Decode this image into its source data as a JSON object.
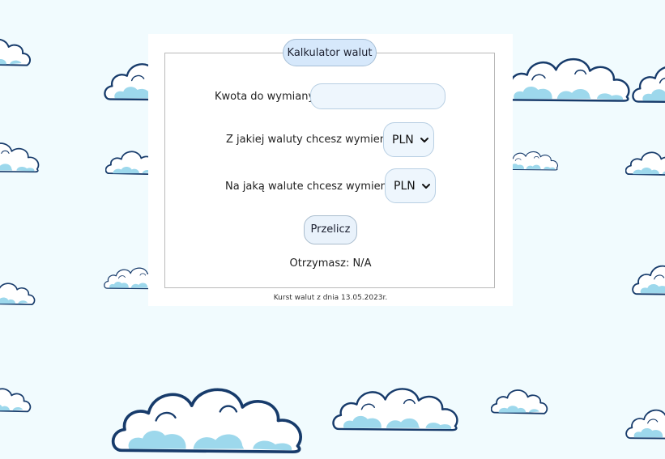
{
  "colors": {
    "page_background": "#f1fbfe",
    "cloud_fill": "#ffffff",
    "cloud_shade": "#9dd8ec",
    "cloud_outline": "#173b6b",
    "legend_fill": "#d6e8fb",
    "input_fill": "#eef6fd"
  },
  "form": {
    "legend": "Kalkulator walut",
    "amount_label": "Kwota do wymiany",
    "amount_value": "",
    "from_label": "Z jakiej waluty chcesz wymienić",
    "from_value": "PLN",
    "to_label": "Na jaką walute chcesz wymienić",
    "to_value": "PLN",
    "submit_label": "Przelicz",
    "result_text": "Otrzymasz: N/A",
    "footnote": "Kurst walut z dnia 13.05.2023r."
  },
  "icons": {
    "select_arrow": "chevron-down-icon",
    "background": "cloud-icon"
  }
}
